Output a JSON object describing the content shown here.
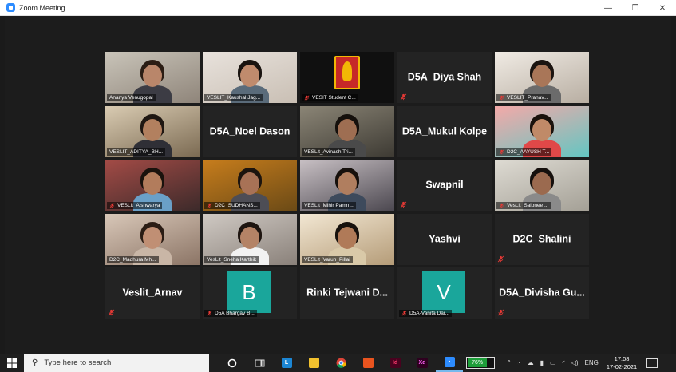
{
  "window": {
    "title": "Zoom Meeting",
    "controls": {
      "minimize": "—",
      "restore": "❐",
      "close": "✕"
    }
  },
  "colors": {
    "active_speaker": "#c7e23a",
    "tile_bg": "#232323",
    "zoom_blue": "#2d8cff"
  },
  "participants": [
    {
      "label": "Ananya Venugopal",
      "type": "video",
      "muted": false
    },
    {
      "label": "VESLIT_Kaushal Jag...",
      "type": "video",
      "muted": false
    },
    {
      "label": "VESIT Student C...",
      "type": "video",
      "muted": true
    },
    {
      "label": "D5A_Diya Shah",
      "type": "name",
      "muted": true
    },
    {
      "label": "VESLIT_Pranav...",
      "type": "video",
      "muted": true
    },
    {
      "label": "VESLIT_ADITYA_BH...",
      "type": "video",
      "muted": false
    },
    {
      "label": "D5A_Noel Dason",
      "type": "name",
      "muted": false
    },
    {
      "label": "VESLit_Avinash Tri...",
      "type": "video",
      "muted": false
    },
    {
      "label": "D5A_Mukul Kolpe",
      "type": "name",
      "muted": false
    },
    {
      "label": "D2C_AAYUSH T...",
      "type": "video",
      "muted": true
    },
    {
      "label": "VESLit_Aishwarya",
      "type": "video",
      "muted": true
    },
    {
      "label": "D2C_SUDHANS...",
      "type": "video",
      "muted": true
    },
    {
      "label": "VESLit_Mihir Pamn...",
      "type": "video",
      "muted": false
    },
    {
      "label": "Swapnil",
      "type": "name",
      "muted": true
    },
    {
      "label": "VesLit_Salonee ...",
      "type": "video",
      "muted": true
    },
    {
      "label": "D2C_Madhura Mh...",
      "type": "video",
      "muted": false
    },
    {
      "label": "VesLit_Sneha Karthik",
      "type": "video",
      "muted": false
    },
    {
      "label": "VESLit_Varun_Pillai",
      "type": "video",
      "muted": false,
      "active": true
    },
    {
      "label": "Yashvi",
      "type": "name",
      "muted": false
    },
    {
      "label": "D2C_Shalini",
      "type": "name",
      "muted": true
    },
    {
      "label": "Veslit_Arnav",
      "type": "name",
      "muted": true
    },
    {
      "label": "D5A Bhargav B...",
      "type": "avatar",
      "letter": "B",
      "muted": true
    },
    {
      "label": "Rinki Tejwani D...",
      "type": "name",
      "muted": false
    },
    {
      "label": "D5A-Vanita Dar...",
      "type": "avatar",
      "letter": "V",
      "muted": true
    },
    {
      "label": "D5A_Divisha Gu...",
      "type": "name",
      "muted": true
    }
  ],
  "taskbar": {
    "search_placeholder": "Type here to search",
    "battery": "76%",
    "language": "ENG",
    "time": "17:08",
    "date": "17-02-2021",
    "apps": [
      "cortana-icon",
      "task-view-icon",
      "libreoffice-icon",
      "file-explorer-icon",
      "chrome-icon",
      "office-icon",
      "indesign-icon",
      "adobe-xd-icon",
      "zoom-icon"
    ]
  }
}
